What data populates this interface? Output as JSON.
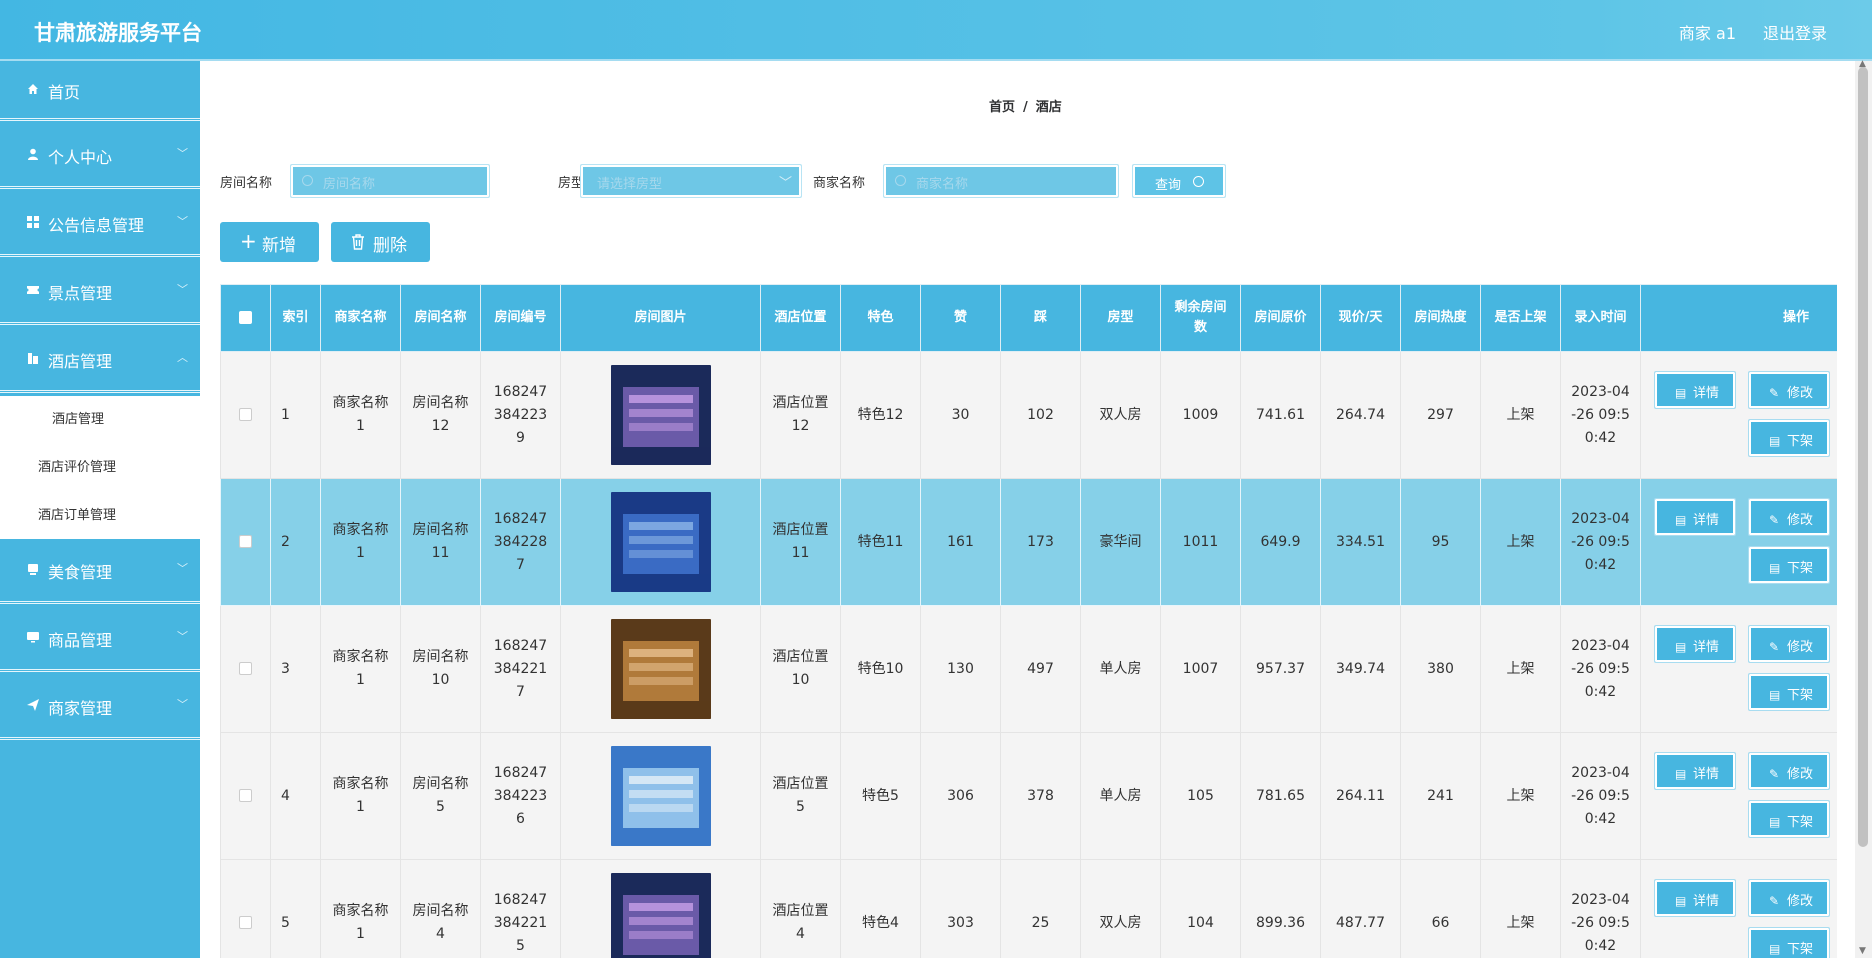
{
  "header": {
    "title": "甘肃旅游服务平台",
    "user": "商家 a1",
    "logout": "退出登录"
  },
  "sidebar": {
    "items": [
      {
        "label": "首页",
        "icon": "home-icon"
      },
      {
        "label": "个人中心",
        "icon": "user-icon"
      },
      {
        "label": "公告信息管理",
        "icon": "grid-icon"
      },
      {
        "label": "景点管理",
        "icon": "ticket-icon"
      },
      {
        "label": "酒店管理",
        "icon": "building-icon"
      },
      {
        "label": "美食管理",
        "icon": "food-icon"
      },
      {
        "label": "商品管理",
        "icon": "monitor-icon"
      },
      {
        "label": "商家管理",
        "icon": "send-icon"
      }
    ],
    "hotel_sub": [
      "酒店管理",
      "酒店评价管理",
      "酒店订单管理"
    ]
  },
  "breadcrumb": {
    "home": "首页",
    "sep": "/",
    "current": "酒店"
  },
  "search": {
    "room_name_label": "房间名称",
    "room_name_placeholder": "房间名称",
    "room_type_label": "房型",
    "room_type_placeholder": "请选择房型",
    "merchant_label": "商家名称",
    "merchant_placeholder": "商家名称",
    "query": "查询"
  },
  "actions": {
    "add": "新增",
    "delete": "删除"
  },
  "table": {
    "headers": [
      "索引",
      "商家名称",
      "房间名称",
      "房间编号",
      "房间图片",
      "酒店位置",
      "特色",
      "赞",
      "踩",
      "房型",
      "剩余房间数",
      "房间原价",
      "现价/天",
      "房间热度",
      "是否上架",
      "录入时间",
      "操作"
    ],
    "ops": {
      "detail": "详情",
      "edit": "修改",
      "off": "下架"
    },
    "rows": [
      {
        "idx": "1",
        "merchant": "商家名称1",
        "room": "房间名称12",
        "no": "1682473842239",
        "location": "酒店位置12",
        "feature": "特色12",
        "like": "30",
        "dislike": "102",
        "type": "双人房",
        "left": "1009",
        "orig": "741.61",
        "price": "264.74",
        "heat": "297",
        "status": "上架",
        "time": "2023-04-26 09:50:42"
      },
      {
        "idx": "2",
        "merchant": "商家名称1",
        "room": "房间名称11",
        "no": "1682473842287",
        "location": "酒店位置11",
        "feature": "特色11",
        "like": "161",
        "dislike": "173",
        "type": "豪华间",
        "left": "1011",
        "orig": "649.9",
        "price": "334.51",
        "heat": "95",
        "status": "上架",
        "time": "2023-04-26 09:50:42"
      },
      {
        "idx": "3",
        "merchant": "商家名称1",
        "room": "房间名称10",
        "no": "1682473842217",
        "location": "酒店位置10",
        "feature": "特色10",
        "like": "130",
        "dislike": "497",
        "type": "单人房",
        "left": "1007",
        "orig": "957.37",
        "price": "349.74",
        "heat": "380",
        "status": "上架",
        "time": "2023-04-26 09:50:42"
      },
      {
        "idx": "4",
        "merchant": "商家名称1",
        "room": "房间名称5",
        "no": "1682473842236",
        "location": "酒店位置5",
        "feature": "特色5",
        "like": "306",
        "dislike": "378",
        "type": "单人房",
        "left": "105",
        "orig": "781.65",
        "price": "264.11",
        "heat": "241",
        "status": "上架",
        "time": "2023-04-26 09:50:42"
      },
      {
        "idx": "5",
        "merchant": "商家名称1",
        "room": "房间名称4",
        "no": "1682473842215",
        "location": "酒店位置4",
        "feature": "特色4",
        "like": "303",
        "dislike": "25",
        "type": "双人房",
        "left": "104",
        "orig": "899.36",
        "price": "487.77",
        "heat": "66",
        "status": "上架",
        "time": "2023-04-26 09:50:42"
      }
    ]
  },
  "colors": {
    "primary": "#47b6e0",
    "highlight_row": "#86d0e8",
    "row_bg": "#f4f4f4"
  }
}
